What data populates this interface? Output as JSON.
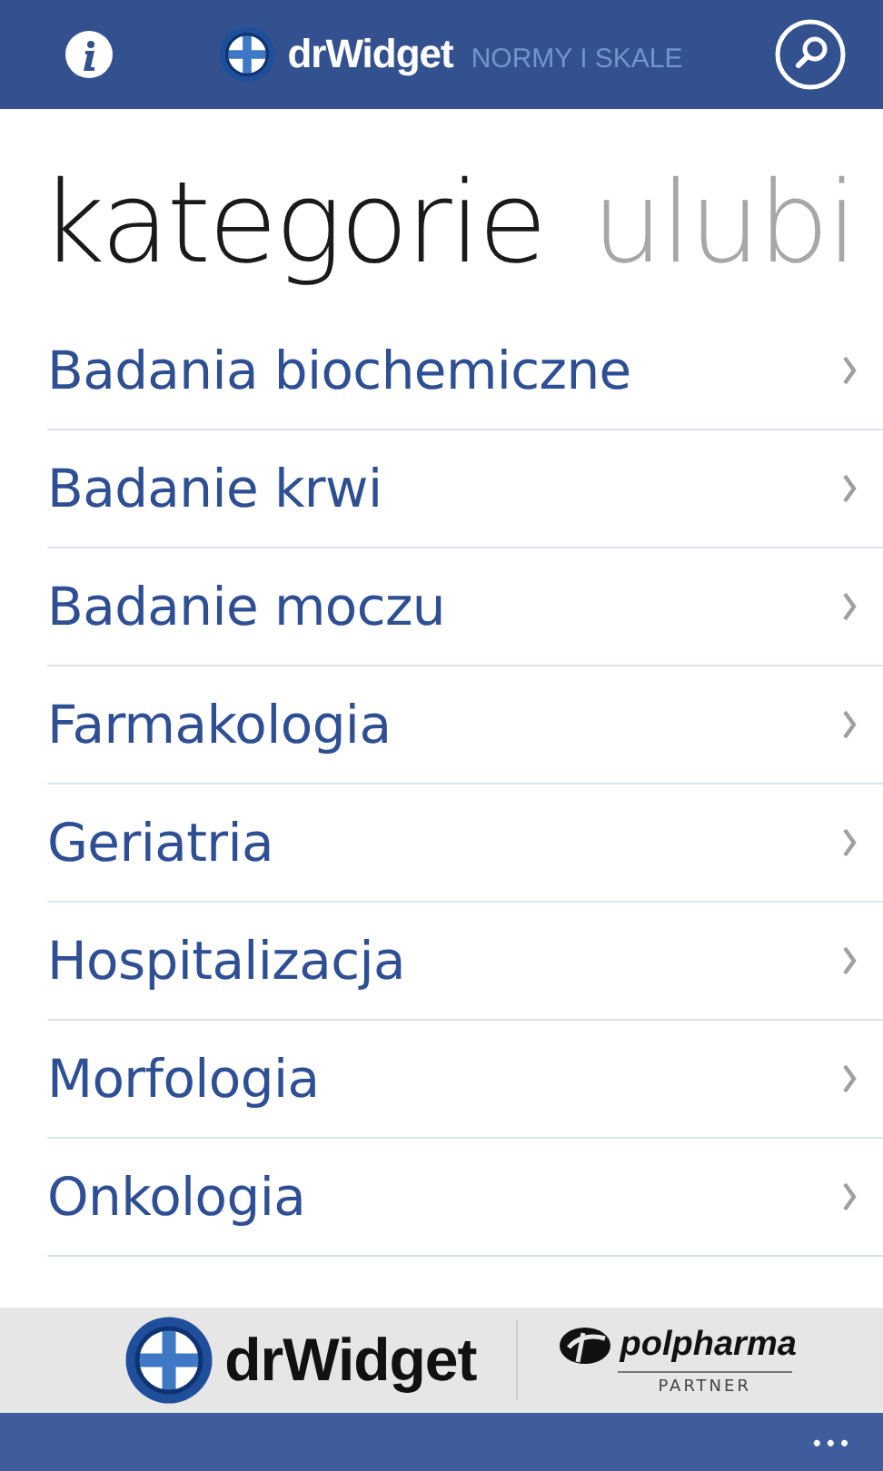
{
  "header": {
    "brand": "drWidget",
    "subtitle": "NORMY I SKALE"
  },
  "pivot": [
    {
      "label": "kategorie",
      "selected": true
    },
    {
      "label": "ulubi",
      "selected": false
    }
  ],
  "categories": [
    "Badania biochemiczne",
    "Badanie krwi",
    "Badanie moczu",
    "Farmakologia",
    "Geriatria",
    "Hospitalizacja",
    "Morfologia",
    "Onkologia"
  ],
  "banner": {
    "brand": "drWidget",
    "partner_name": "polpharma",
    "partner_label": "PARTNER"
  },
  "app_bar": {
    "more": "•••"
  }
}
